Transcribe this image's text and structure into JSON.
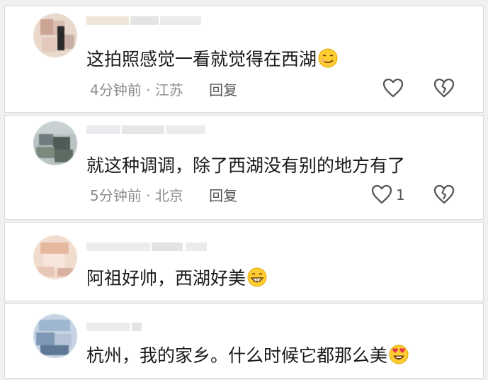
{
  "comments": [
    {
      "text": "这拍照感觉一看就觉得在西湖",
      "emoji": "smirk-face-emoji",
      "time": "4分钟前",
      "separator": "·",
      "location": "江苏",
      "reply": "回复",
      "like_icon": "heart-outline-icon",
      "like_count": "",
      "dislike_icon": "broken-heart-outline-icon"
    },
    {
      "text": "就这种调调，除了西湖没有别的地方有了",
      "emoji": "",
      "time": "5分钟前",
      "separator": "·",
      "location": "北京",
      "reply": "回复",
      "like_icon": "heart-outline-icon",
      "like_count": "1",
      "dislike_icon": "broken-heart-outline-icon"
    },
    {
      "text": "阿祖好帅，西湖好美",
      "emoji": "grinning-face-emoji",
      "time": "",
      "location": "",
      "reply": ""
    },
    {
      "text": "杭州，我的家乡。什么时候它都那么美",
      "emoji": "heart-eyes-face-emoji",
      "time": "",
      "location": "",
      "reply": ""
    }
  ],
  "colors": {
    "background": "#f0f0f0",
    "card": "#ffffff",
    "text": "#1a1a1a",
    "meta": "#8c8c8c",
    "icon": "#555555",
    "emoji_yellow": "#ffcc33"
  }
}
